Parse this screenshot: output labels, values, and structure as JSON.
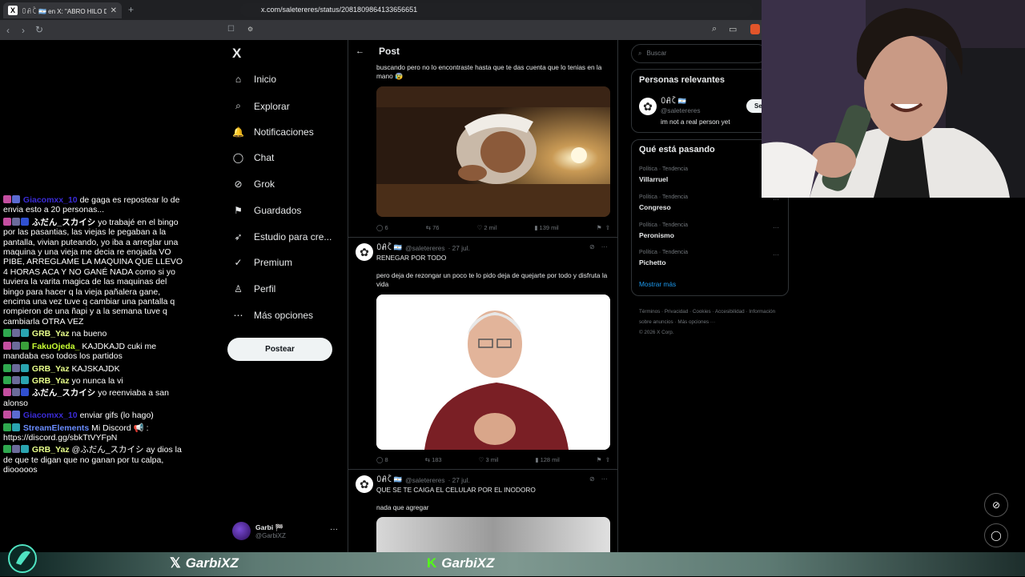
{
  "browser": {
    "tab_title": "ꄲꋬꉓ 🇦🇷 en X: \"ABRO HILO DE TO",
    "url": "x.com/saletereres/status/2081809864133656651"
  },
  "chat": [
    {
      "user": "Giacomxx_10",
      "user_color": "#3a2bd6",
      "text": "de gaga es repostear lo de envia esto a 20 personas...",
      "badges": [
        "#c44ea0",
        "#5b6bd1"
      ]
    },
    {
      "user": "ふだん_スカイシ",
      "user_color": "#ffffff",
      "text": "yo trabajé en el bingo por las pasantias, las viejas le pegaban a la pantalla, vivian puteando, yo iba a arreglar una maquina y una vieja me decia re enojada VO PIBE, ARREGLAME LA MAQUINA QUE LLEVO 4 HORAS ACA Y NO GANÉ NADA como si yo tuviera la varita magica de las maquinas del bingo para hacer q la vieja pañalera gane, encima una vez tuve q cambiar una pantalla q rompieron de una ñapi y a la semana tuve q cambiarla OTRA VEZ",
      "badges": [
        "#c44ea0",
        "#6b6b9a",
        "#3050d0"
      ]
    },
    {
      "user": "GRB_Yaz",
      "user_color": "#e8ff8a",
      "text": "na bueno",
      "badges": [
        "#2fa84f",
        "#6b6b9a",
        "#2aa4b0"
      ]
    },
    {
      "user": "FakuOjeda_",
      "user_color": "#c8ff33",
      "text": "KAJDKAJD cuki me mandaba eso todos los partidos",
      "badges": [
        "#c44ea0",
        "#6b6b9a",
        "#3aa03a"
      ]
    },
    {
      "user": "GRB_Yaz",
      "user_color": "#e8ff8a",
      "text": "KAJSKAJDK",
      "badges": [
        "#2fa84f",
        "#6b6b9a",
        "#2aa4b0"
      ]
    },
    {
      "user": "GRB_Yaz",
      "user_color": "#e8ff8a",
      "text": "yo nunca la vi",
      "badges": [
        "#2fa84f",
        "#6b6b9a",
        "#2aa4b0"
      ]
    },
    {
      "user": "ふだん_スカイシ",
      "user_color": "#ffffff",
      "text": "yo reenviaba a san alonso",
      "badges": [
        "#c44ea0",
        "#6b6b9a",
        "#3050d0"
      ]
    },
    {
      "user": "Giacomxx_10",
      "user_color": "#3a2bd6",
      "text": "enviar gifs (lo hago)",
      "badges": [
        "#c44ea0",
        "#5b6bd1"
      ]
    },
    {
      "user": "StreamElements",
      "user_color": "#6a8cff",
      "text": "Mi Discord 📢 : https://discord.gg/sbkTtVYFpN",
      "badges": [
        "#2fa84f",
        "#2aa4b0"
      ]
    },
    {
      "user": "GRB_Yaz",
      "user_color": "#e8ff8a",
      "text": "@ふだん_スカイシ ay dios la de que te digan que no ganan por tu calpa, diooooos",
      "badges": [
        "#2fa84f",
        "#6b6b9a",
        "#2aa4b0"
      ]
    }
  ],
  "nav": {
    "logo": "X",
    "items": [
      {
        "label": "Inicio",
        "icon": "⌂"
      },
      {
        "label": "Explorar",
        "icon": "⌕"
      },
      {
        "label": "Notificaciones",
        "icon": "🔔"
      },
      {
        "label": "Chat",
        "icon": "◯"
      },
      {
        "label": "Grok",
        "icon": "⊘"
      },
      {
        "label": "Guardados",
        "icon": "⚑"
      },
      {
        "label": "Estudio para cre...",
        "icon": "➶"
      },
      {
        "label": "Premium",
        "icon": "✓"
      },
      {
        "label": "Perfil",
        "icon": "♙"
      },
      {
        "label": "Más opciones",
        "icon": "⋯"
      }
    ],
    "post_button": "Postear",
    "account_name": "Garbi 🏁",
    "account_handle": "@GarbiXZ"
  },
  "header": {
    "title": "Post"
  },
  "posts": [
    {
      "text": "buscando pero no lo encontraste hasta que te das cuenta que lo tenias en la mano 😰",
      "replies": "6",
      "reposts": "76",
      "likes": "2 mil",
      "views": "139 mil"
    },
    {
      "author": "ꄲꋬꉓ 🇦🇷",
      "handle": "@saletereres",
      "date": "· 27 jul.",
      "title": "RENEGAR POR TODO",
      "text": "pero deja de rezongar un poco te lo pido deja de quejarte por todo y disfruta la vida",
      "replies": "8",
      "reposts": "183",
      "likes": "3 mil",
      "views": "128 mil"
    },
    {
      "author": "ꄲꋬꉓ 🇦🇷",
      "handle": "@saletereres",
      "date": "· 27 jul.",
      "title": "QUE SE TE CAIGA EL CELULAR POR EL INODORO",
      "text": "nada que agregar"
    }
  ],
  "right": {
    "search_placeholder": "Buscar",
    "relevant_title": "Personas relevantes",
    "person_name": "ꄲꋬꉓ 🇦🇷",
    "person_handle": "@saletereres",
    "person_bio": "im not a real person yet",
    "follow_label": "Se",
    "trends_title": "Qué está pasando",
    "trends": [
      {
        "category": "Política · Tendencia",
        "name": "Villarruel"
      },
      {
        "category": "Política · Tendencia",
        "name": "Congreso"
      },
      {
        "category": "Política · Tendencia",
        "name": "Peronismo"
      },
      {
        "category": "Política · Tendencia",
        "name": "Pichetto"
      }
    ],
    "show_more": "Mostrar más",
    "footer": [
      "Términos",
      "Privacidad",
      "Cookies",
      "Accesibilidad",
      "Información sobre anuncios",
      "Más opciones ···",
      "© 2026 X Corp."
    ]
  },
  "banner": {
    "left": "GarbiXZ",
    "right": "GarbiXZ"
  }
}
